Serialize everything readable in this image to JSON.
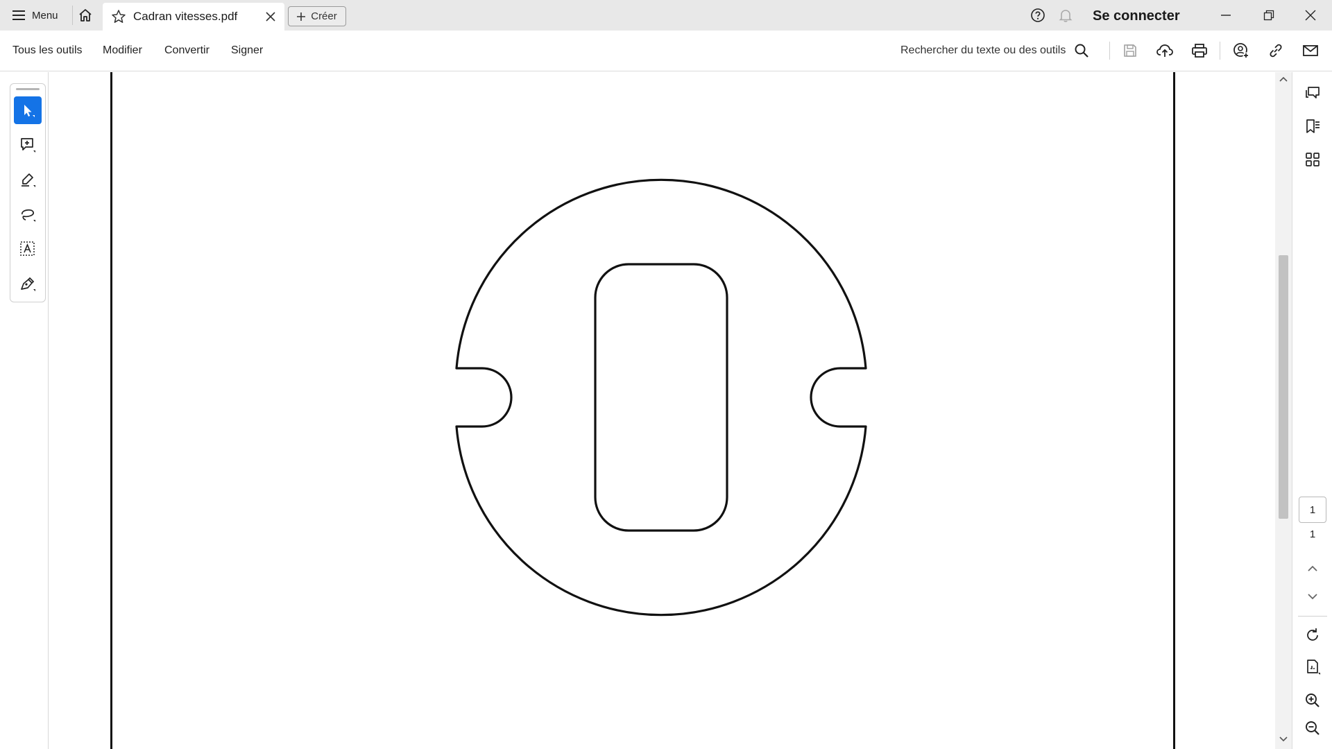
{
  "titlebar": {
    "menu_label": "Menu",
    "tab_title": "Cadran vitesses.pdf",
    "create_label": "Créer",
    "signin_label": "Se connecter"
  },
  "toolbar": {
    "menus": [
      "Tous les outils",
      "Modifier",
      "Convertir",
      "Signer"
    ],
    "search_placeholder": "Rechercher du texte ou des outils"
  },
  "left_tools": [
    "select-tool",
    "add-comment-tool",
    "highlight-tool",
    "freehand-draw-tool",
    "text-select-tool",
    "sign-tool"
  ],
  "right_rail": {
    "current_page": "1",
    "total_pages": "1"
  },
  "document": {
    "title": "Cadran vitesses.pdf"
  },
  "colors": {
    "accent": "#1473e6",
    "titlebar_bg": "#e8e8e8",
    "drawing_stroke": "#111111"
  }
}
